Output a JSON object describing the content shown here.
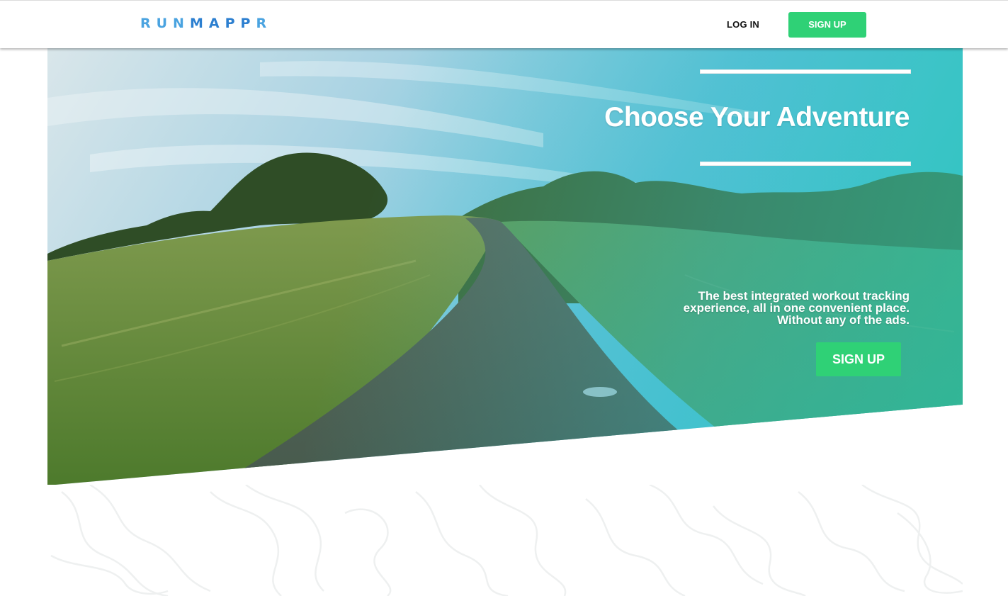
{
  "header": {
    "logo_start": "RUN",
    "logo_mid": "MAPP",
    "logo_end": "R",
    "login_label": "LOG IN",
    "signup_label": "SIGN UP"
  },
  "hero": {
    "headline": "Choose Your Adventure",
    "tagline_line1": "The best integrated workout tracking",
    "tagline_line2": "experience, all in one convenient place.",
    "tagline_line3": "Without any of the ads.",
    "cta_label": "SIGN UP"
  },
  "colors": {
    "accent_green": "#2fd176",
    "logo_blue": "#4aa3e0",
    "logo_blue_dark": "#2c7fd0",
    "hero_tint": "#3cc6c8"
  }
}
